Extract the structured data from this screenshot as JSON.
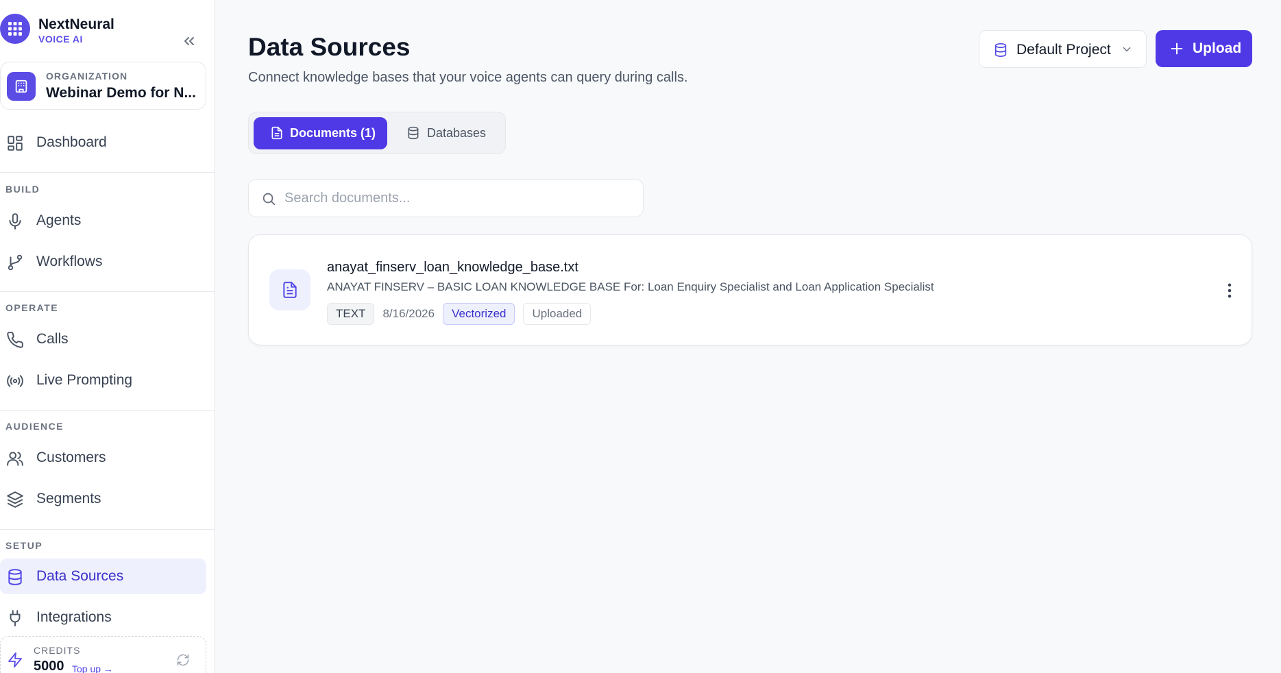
{
  "brand": {
    "name": "NextNeural",
    "subtitle": "VOICE AI"
  },
  "organization": {
    "label": "ORGANIZATION",
    "name": "Webinar Demo for N..."
  },
  "nav": {
    "dashboard": "Dashboard",
    "sections": {
      "build": "BUILD",
      "operate": "OPERATE",
      "audience": "AUDIENCE",
      "setup": "SETUP"
    },
    "items": {
      "agents": "Agents",
      "workflows": "Workflows",
      "calls": "Calls",
      "live_prompting": "Live Prompting",
      "customers": "Customers",
      "segments": "Segments",
      "data_sources": "Data Sources",
      "integrations": "Integrations"
    },
    "active": "data_sources"
  },
  "credits": {
    "label": "CREDITS",
    "value": "5000",
    "topup": "Top up →"
  },
  "page": {
    "title": "Data Sources",
    "subtitle": "Connect knowledge bases that your voice agents can query during calls."
  },
  "project_select": {
    "value": "Default Project"
  },
  "upload": {
    "label": "Upload"
  },
  "tabs": [
    {
      "label": "Documents (1)",
      "active": true
    },
    {
      "label": "Databases",
      "active": false
    }
  ],
  "search": {
    "placeholder": "Search documents...",
    "value": ""
  },
  "documents": [
    {
      "name": "anayat_finserv_loan_knowledge_base.txt",
      "description": "ANAYAT FINSERV – BASIC LOAN KNOWLEDGE BASE For: Loan Enquiry Specialist and Loan Application Specialist",
      "type": "TEXT",
      "date": "8/16/2026",
      "status_vector": "Vectorized",
      "status_upload": "Uploaded"
    }
  ],
  "colors": {
    "accent": "#4f39e6",
    "accent_light": "#eef0fe",
    "background": "#f8f9fb",
    "text": "#111827",
    "muted": "#6b7280"
  },
  "icons": {
    "brand": "grid-icon",
    "collapse": "chevrons-left-icon",
    "org": "building-icon",
    "dashboard": "layout-grid-icon",
    "agents": "microphone-icon",
    "workflows": "git-branch-icon",
    "calls": "phone-icon",
    "live_prompting": "broadcast-icon",
    "customers": "users-icon",
    "segments": "layers-icon",
    "data_sources": "database-icon",
    "integrations": "plug-icon",
    "credits": "bolt-icon",
    "refresh": "refresh-icon",
    "project": "database-icon",
    "upload": "plus-icon",
    "documents_tab": "file-text-icon",
    "databases_tab": "database-icon",
    "search": "search-icon",
    "document": "file-text-icon",
    "more": "more-vertical-icon"
  }
}
